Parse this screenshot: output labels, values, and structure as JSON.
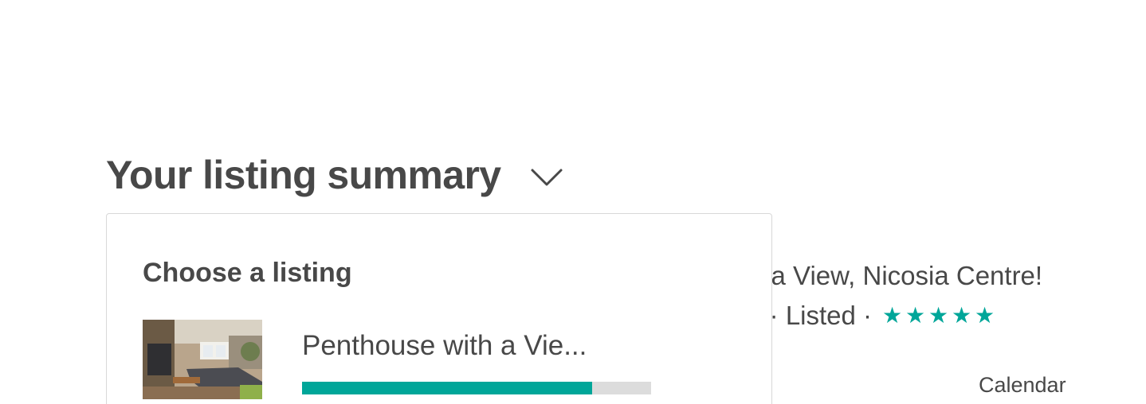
{
  "header": {
    "title": "Your listing summary"
  },
  "background_listing": {
    "title_fragment": "n a View, Nicosia Centre!",
    "meta_fragment": "s · Listed · ",
    "rating_stars": 5,
    "calendar_label": "Calendar"
  },
  "dropdown": {
    "title": "Choose a listing",
    "options": [
      {
        "title": "Penthouse with a Vie...",
        "progress": 0.83
      }
    ]
  },
  "colors": {
    "accent": "#00a699",
    "text": "#484848",
    "track": "#dcdcdc"
  }
}
